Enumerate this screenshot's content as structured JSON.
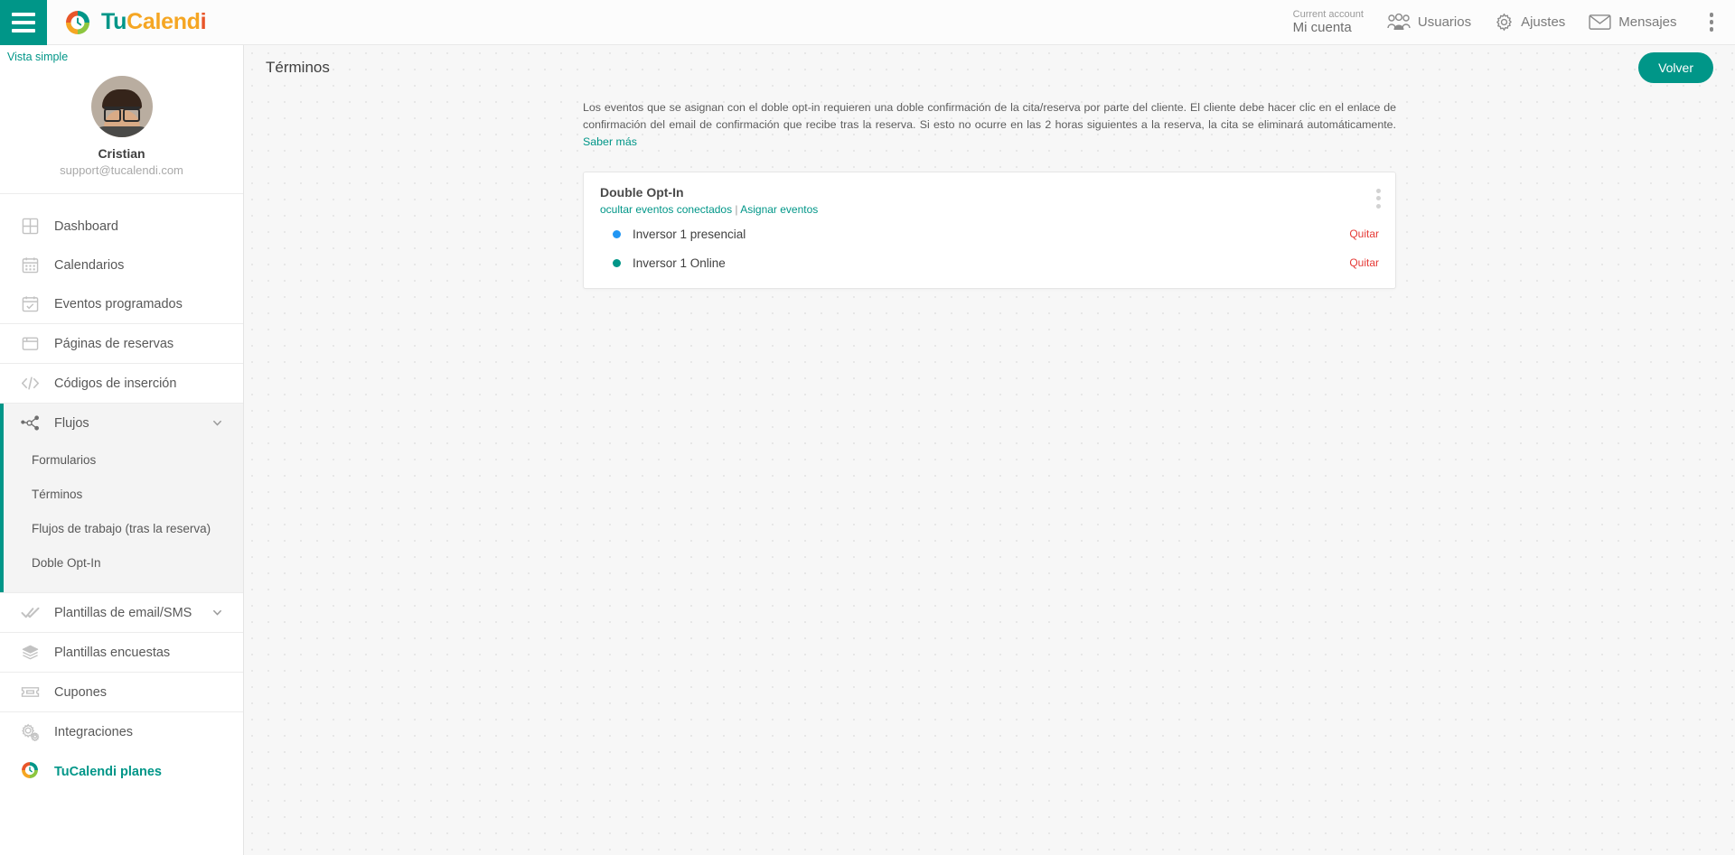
{
  "brand": {
    "name_parts": [
      "Tu",
      "C",
      "alend",
      "i"
    ],
    "logo_icon": "tucalendi-logo-icon",
    "accent": "#009688"
  },
  "topbar": {
    "menu_toggle_icon": "hamburger-icon",
    "account": {
      "label": "Current account",
      "value": "Mi cuenta"
    },
    "nav": [
      {
        "label": "Usuarios",
        "icon": "users-icon"
      },
      {
        "label": "Ajustes",
        "icon": "gear-icon"
      },
      {
        "label": "Mensajes",
        "icon": "envelope-icon"
      }
    ],
    "overflow_icon": "kebab-menu-icon"
  },
  "sidebar": {
    "simple_view_link": "Vista simple",
    "profile": {
      "name": "Cristian",
      "email": "support@tucalendi.com",
      "avatar_icon": "user-avatar"
    },
    "items": [
      {
        "label": "Dashboard",
        "icon": "grid-icon"
      },
      {
        "label": "Calendarios",
        "icon": "calendar-icon"
      },
      {
        "label": "Eventos programados",
        "icon": "calendar-check-icon"
      },
      {
        "label": "Páginas de reservas",
        "icon": "browser-window-icon"
      },
      {
        "label": "Códigos de inserción",
        "icon": "code-icon"
      }
    ],
    "flujos": {
      "label": "Flujos",
      "icon": "nodes-icon",
      "expanded": true,
      "chevron_icon": "chevron-down-icon",
      "subitems": [
        {
          "label": "Formularios"
        },
        {
          "label": "Términos"
        },
        {
          "label": "Flujos de trabajo (tras la reserva)"
        },
        {
          "label": "Doble Opt-In"
        }
      ]
    },
    "items_after": [
      {
        "label": "Plantillas de email/SMS",
        "icon": "double-check-icon",
        "chevron_icon": "chevron-down-icon",
        "has_chevron": true
      },
      {
        "label": "Plantillas encuestas",
        "icon": "layers-icon",
        "has_chevron": false
      },
      {
        "label": "Cupones",
        "icon": "ticket-icon",
        "has_chevron": false
      },
      {
        "label": "Integraciones",
        "icon": "gears-icon",
        "has_chevron": false
      }
    ],
    "plans_link": {
      "label": "TuCalendi planes",
      "icon": "tucalendi-logo-icon"
    }
  },
  "page": {
    "title": "Términos",
    "back_button": "Volver",
    "description": "Los eventos que se asignan con el doble opt-in requieren una doble confirmación de la cita/reserva por parte del cliente. El cliente debe hacer clic en el enlace de confirmación del email de confirmación que recibe tras la reserva. Si esto no ocurre en las 2 horas siguientes a la reserva, la cita se eliminará automáticamente. ",
    "description_link": "Saber más"
  },
  "card": {
    "title": "Double Opt-In",
    "link_hide": "ocultar eventos conectados",
    "link_separator": " | ",
    "link_assign": "Asignar eventos",
    "overflow_icon": "kebab-menu-icon",
    "events": [
      {
        "name": "Inversor 1 presencial",
        "color": "#2196f3",
        "action": "Quitar"
      },
      {
        "name": "Inversor 1 Online",
        "color": "#009688",
        "action": "Quitar"
      }
    ]
  }
}
